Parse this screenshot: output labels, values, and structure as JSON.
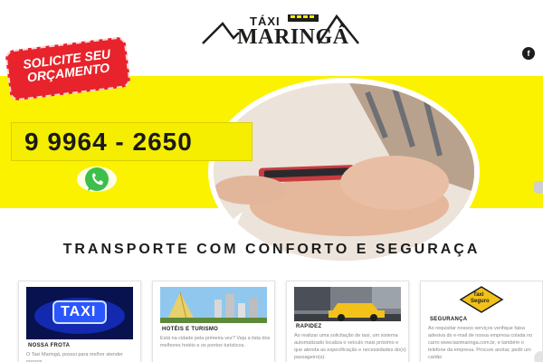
{
  "header": {
    "logo_top": "TÁXI",
    "logo_main": "MARINGÁ",
    "facebook_icon": "f"
  },
  "hero": {
    "stamp_line1": "SOLICITE SEU",
    "stamp_line2": "ORÇAMENTO",
    "phone": "9  9964 - 2650",
    "accent_color": "#fbf200",
    "stamp_color": "#e8232c"
  },
  "section": {
    "title": "TRANSPORTE COM CONFORTO E SEGURAÇA"
  },
  "cards": [
    {
      "title": "NOSSA FROTA",
      "text": "O Taxi Maringá, possui para melhor atender nossos",
      "sign": "TAXI"
    },
    {
      "title": "HOTÉIS E TURISMO",
      "text": "Está na cidade pela primeira vez? Veja a lista dos melhores hotéis e os pontos turísticos."
    },
    {
      "title": "RAPIDEZ",
      "text": "Ao realizar uma solicitação de taxi, um sistema automatizado localiza o veículo mais próximo e que atenda as especificação e necessidades do(s) passageiro(s)."
    },
    {
      "title": "SEGURANÇA",
      "text": "Ao requisitar nossos serviços verifique faixa adesiva do e-mail de nossa empresa colada no carro www.taximaringa.com.br, e também o telefone da empresa. Procure anotar, pedir um cartão",
      "sign_line1": "Taxi",
      "sign_line2": "Seguro"
    }
  ]
}
